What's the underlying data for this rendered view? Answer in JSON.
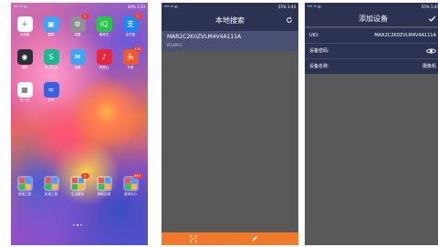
{
  "phone1": {
    "status_left": "⁵⁶ᴳ ⁴ᴳ ✆",
    "status_right": "40% 1:33",
    "apps": [
      {
        "id": "calc",
        "label": "计算器",
        "color": "#ffffff",
        "glyph": "＋",
        "badge": ""
      },
      {
        "id": "gallery",
        "label": "图库",
        "color": "#3fa4f6",
        "glyph": "▣",
        "badge": ""
      },
      {
        "id": "settings",
        "label": "设置",
        "color": "#8e9096",
        "glyph": "⚙",
        "badge": "1"
      },
      {
        "id": "iqiyi",
        "label": "爱奇艺",
        "color": "#27c74a",
        "glyph": "iQ",
        "badge": ""
      },
      {
        "id": "alipay",
        "label": "支付宝",
        "color": "#1b8af0",
        "glyph": "支",
        "badge": "2"
      },
      {
        "id": "camera",
        "label": "相机",
        "color": "#2b2f36",
        "glyph": "◉",
        "badge": ""
      },
      {
        "id": "app7",
        "label": "掌上生活",
        "color": "#1eb98f",
        "glyph": "S",
        "badge": ""
      },
      {
        "id": "messages",
        "label": "信息",
        "color": "#3fa4f6",
        "glyph": "✉",
        "badge": ""
      },
      {
        "id": "music",
        "label": "网易云",
        "color": "#e8253e",
        "glyph": "♪",
        "badge": ""
      },
      {
        "id": "app10",
        "label": "头条",
        "color": "#f05a28",
        "glyph": "头",
        "badge": "134"
      },
      {
        "id": "qrapp",
        "label": "扫一扫",
        "color": "#ffffff",
        "glyph": "▦",
        "badge": ""
      },
      {
        "id": "weather",
        "label": "天气",
        "color": "#3a5fe0",
        "glyph": "≈",
        "badge": ""
      }
    ],
    "folders": [
      {
        "label": "系统工具",
        "badge": ""
      },
      {
        "label": "实用工具",
        "badge": ""
      },
      {
        "label": "生活服务",
        "badge": "4"
      },
      {
        "label": "精品应用",
        "badge": ""
      },
      {
        "label": "游戏中心",
        "badge": "99+"
      }
    ]
  },
  "phone2": {
    "status_left": "⁵⁶ᴳ ⁴ᴳ ✆",
    "status_right": "55% 1:44",
    "title": "本地搜索",
    "device_uid": "MAR2C2K0ZVLM4V4A111A",
    "device_sub": "IPCAM-1"
  },
  "phone3": {
    "status_left": "⁵⁶ᴳ ⁴ᴳ ✆",
    "status_right": "55% 1:44",
    "title": "添加设备",
    "uid_label": "UID:",
    "uid_value": "MAR2C2K0ZVLM4V4A111A",
    "password_label": "设备密码:",
    "name_label": "设备名称:",
    "name_value": "摄像机"
  }
}
